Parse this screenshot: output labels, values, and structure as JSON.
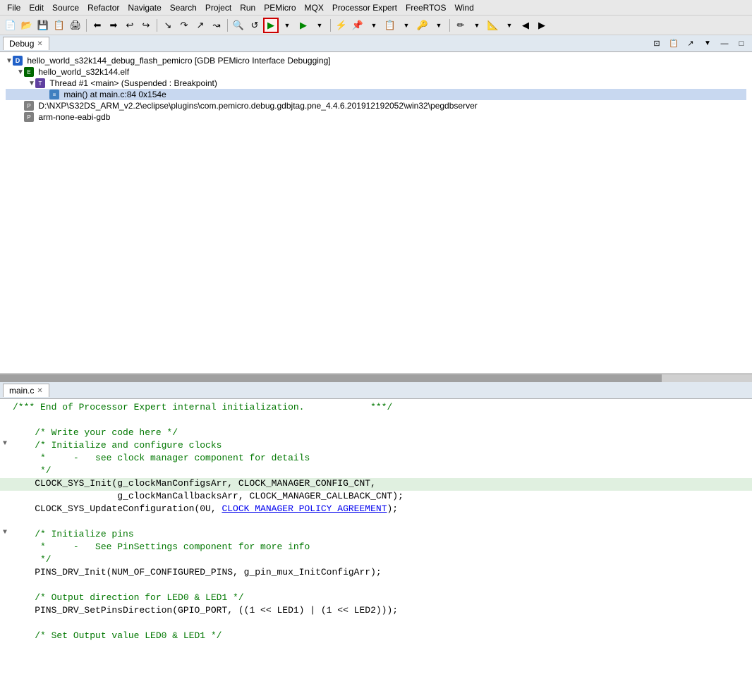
{
  "menubar": {
    "items": [
      "File",
      "Edit",
      "Source",
      "Refactor",
      "Navigate",
      "Search",
      "Project",
      "Run",
      "PEMicro",
      "MQX",
      "Processor Expert",
      "FreeRTOS",
      "Wind"
    ]
  },
  "toolbar": {
    "buttons": [
      "⏮",
      "◀▌",
      "▶▌",
      "⏹",
      "⏺",
      "⏩",
      "↪",
      "↩",
      "⟲",
      "⟳",
      "▶",
      "⚙",
      "⚙▼",
      "▶",
      "▶▼",
      "🐛",
      "🐛▼",
      "📎",
      "📎▼",
      "🔒",
      "🔒▼",
      "🔑",
      "✏",
      "✏▼",
      "📐",
      "📐▼",
      "↙",
      "↗",
      "←",
      "→"
    ]
  },
  "debug_panel": {
    "tab_label": "Debug",
    "tab_close": "✕",
    "tree": {
      "session": "hello_world_s32k144_debug_flash_pemicro [GDB PEMicro Interface Debugging]",
      "elf": "hello_world_s32k144.elf",
      "thread": "Thread #1 <main> (Suspended : Breakpoint)",
      "frame": "main() at main.c:84 0x154e",
      "process1": "D:\\NXP\\S32DS_ARM_v2.2\\eclipse\\plugins\\com.pemicro.debug.gdbjtag.pne_4.4.6.201912192052\\win32\\pegdbserver",
      "process2": "arm-none-eabi-gdb"
    },
    "toolbar_icons": [
      "⊡",
      "📋",
      "↗",
      "▼",
      "—",
      "□"
    ]
  },
  "editor": {
    "tab_label": "main.c",
    "tab_close": "✕",
    "code_lines": [
      {
        "num": "",
        "fold": "",
        "text": "    /*** End of Processor Expert internal initialization.            ***/",
        "type": "comment"
      },
      {
        "num": "",
        "fold": "",
        "text": "",
        "type": "blank"
      },
      {
        "num": "",
        "fold": "",
        "text": "    /* Write your code here */",
        "type": "comment"
      },
      {
        "num": "",
        "fold": "▼",
        "text": "    /* Initialize and configure clocks",
        "type": "comment"
      },
      {
        "num": "",
        "fold": "",
        "text": "     *     -   see clock manager component for details",
        "type": "comment"
      },
      {
        "num": "",
        "fold": "",
        "text": "     */",
        "type": "comment"
      },
      {
        "num": "",
        "fold": "",
        "text": "    CLOCK_SYS_Init(g_clockManConfigsArr, CLOCK_MANAGER_CONFIG_CNT,",
        "type": "highlight"
      },
      {
        "num": "",
        "fold": "",
        "text": "                   g_clockManCallbacksArr, CLOCK_MANAGER_CALLBACK_CNT);",
        "type": "normal"
      },
      {
        "num": "",
        "fold": "",
        "text": "    CLOCK_SYS_UpdateConfiguration(0U, CLOCK_MANAGER_POLICY_AGREEMENT);",
        "type": "normal_link"
      },
      {
        "num": "",
        "fold": "",
        "text": "",
        "type": "blank"
      },
      {
        "num": "",
        "fold": "▼",
        "text": "    /* Initialize pins",
        "type": "comment"
      },
      {
        "num": "",
        "fold": "",
        "text": "     *     -   See PinSettings component for more info",
        "type": "comment"
      },
      {
        "num": "",
        "fold": "",
        "text": "     */",
        "type": "comment"
      },
      {
        "num": "",
        "fold": "",
        "text": "    PINS_DRV_Init(NUM_OF_CONFIGURED_PINS, g_pin_mux_InitConfigArr);",
        "type": "normal"
      },
      {
        "num": "",
        "fold": "",
        "text": "",
        "type": "blank"
      },
      {
        "num": "",
        "fold": "",
        "text": "    /* Output direction for LED0 & LED1 */",
        "type": "comment"
      },
      {
        "num": "",
        "fold": "",
        "text": "    PINS_DRV_SetPinsDirection(GPIO_PORT, ((1 << LED1) | (1 << LED2)));",
        "type": "normal"
      },
      {
        "num": "",
        "fold": "",
        "text": "",
        "type": "blank"
      },
      {
        "num": "",
        "fold": "",
        "text": "    /* Set Output value LED0 & LED1 */",
        "type": "comment"
      }
    ]
  },
  "colors": {
    "accent": "#2060c8",
    "highlight_run": "#cc0000",
    "code_highlight_bg": "#e0f0e0",
    "selected_bg": "#c8d8f0"
  }
}
